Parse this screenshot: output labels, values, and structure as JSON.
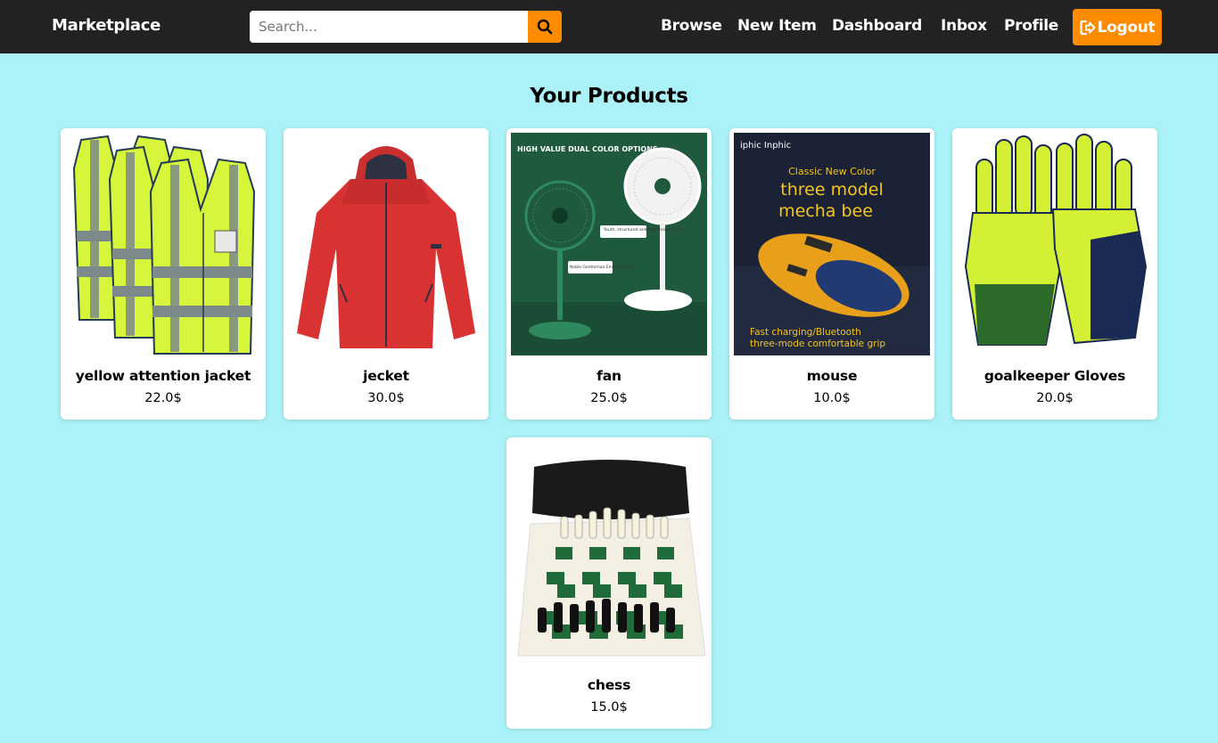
{
  "nav": {
    "brand": "Marketplace",
    "search_placeholder": "Search...",
    "links": [
      "Browse",
      "New Item",
      "Dashboard",
      "Inbox",
      "Profile"
    ],
    "logout_label": "Logout",
    "accent_color": "#ff8c00",
    "bar_color": "#222222"
  },
  "page": {
    "title": "Your Products",
    "background": "#aaf2f8"
  },
  "products": [
    {
      "name": "yellow attention jacket",
      "price": "22.0$",
      "image": "safety-vest-image"
    },
    {
      "name": "jecket",
      "price": "30.0$",
      "image": "red-jacket-image"
    },
    {
      "name": "fan",
      "price": "25.0$",
      "image": "fan-image",
      "image_text": {
        "headline": "HIGH VALUE DUAL COLOR OPTIONS",
        "callout_1": "Youth, structured and fashionable white",
        "callout_2": "Noble Gentleman Emerald Green"
      }
    },
    {
      "name": "mouse",
      "price": "10.0$",
      "image": "mouse-image",
      "image_text": {
        "brand": "iphic Inphic",
        "tag": "Classic New Color",
        "line1": "three model",
        "line2": "mecha bee",
        "foot1": "Fast charging/Bluetooth",
        "foot2": "three-mode comfortable grip"
      }
    },
    {
      "name": "goalkeeper Gloves",
      "price": "20.0$",
      "image": "gloves-image"
    },
    {
      "name": "chess",
      "price": "15.0$",
      "image": "chess-set-image"
    }
  ]
}
